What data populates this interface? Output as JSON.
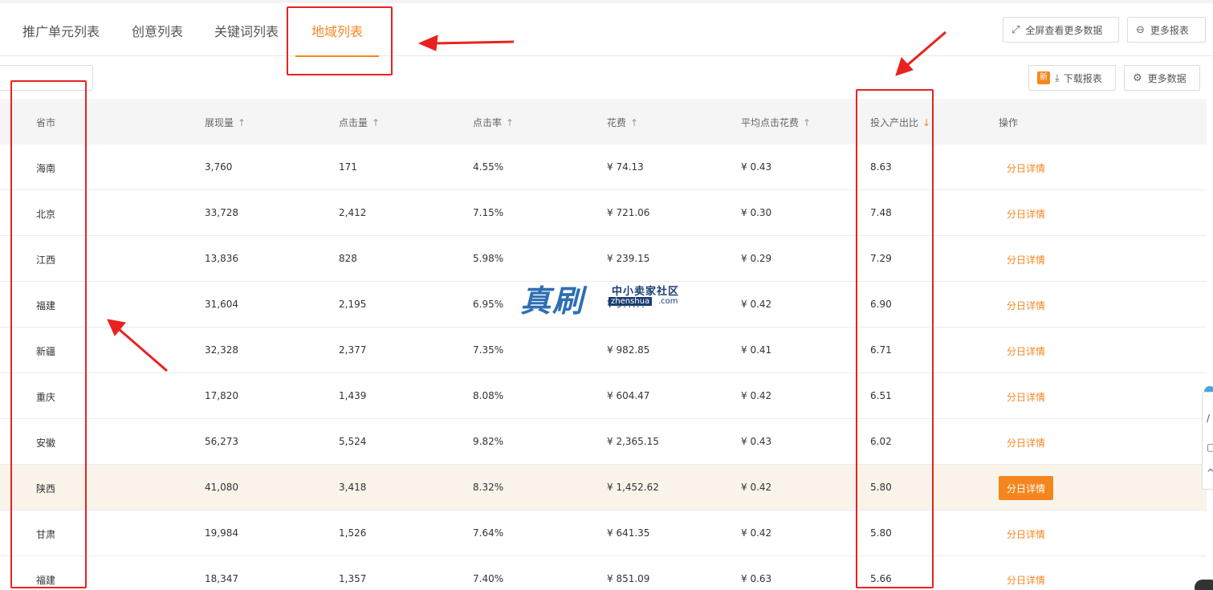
{
  "tabs": [
    {
      "label": "推广单元列表"
    },
    {
      "label": "创意列表"
    },
    {
      "label": "关键词列表"
    },
    {
      "label": "地域列表"
    }
  ],
  "toolbar": {
    "fullscreen_label": "全屏查看更多数据",
    "more_reports_label": "更多报表",
    "new_badge": "新",
    "download_label": "下载报表",
    "more_data_label": "更多数据"
  },
  "table": {
    "headers": [
      "省市",
      "展现量",
      "点击量",
      "点击率",
      "花费",
      "平均点击花费",
      "投入产出比",
      "操作"
    ],
    "action_label": "分日详情",
    "rows": [
      [
        "海南",
        "3,760",
        "171",
        "4.55%",
        "¥ 74.13",
        "¥ 0.43",
        "8.63"
      ],
      [
        "北京",
        "33,728",
        "2,412",
        "7.15%",
        "¥ 721.06",
        "¥ 0.30",
        "7.48"
      ],
      [
        "江西",
        "13,836",
        "828",
        "5.98%",
        "¥ 239.15",
        "¥ 0.29",
        "7.29"
      ],
      [
        "福建",
        "31,604",
        "2,195",
        "6.95%",
        "¥ 9??.??",
        "¥ 0.42",
        "6.90"
      ],
      [
        "新疆",
        "32,328",
        "2,377",
        "7.35%",
        "¥ 982.85",
        "¥ 0.41",
        "6.71"
      ],
      [
        "重庆",
        "17,820",
        "1,439",
        "8.08%",
        "¥ 604.47",
        "¥ 0.42",
        "6.51"
      ],
      [
        "安徽",
        "56,273",
        "5,524",
        "9.82%",
        "¥ 2,365.15",
        "¥ 0.43",
        "6.02"
      ],
      [
        "陕西",
        "41,080",
        "3,418",
        "8.32%",
        "¥ 1,452.62",
        "¥ 0.42",
        "5.80"
      ],
      [
        "甘肃",
        "19,984",
        "1,526",
        "7.64%",
        "¥ 641.35",
        "¥ 0.42",
        "5.80"
      ],
      [
        "福建",
        "18,347",
        "1,357",
        "7.40%",
        "¥ 851.09",
        "¥ 0.63",
        "5.66"
      ]
    ]
  },
  "watermark": {
    "big": "真刷",
    "small": "中小卖家社区",
    "url": "zhenshua",
    "com": ".com"
  },
  "colors": {
    "accent": "#f5861f",
    "annotation_red": "#e8231f",
    "highlight_row": "#f9f3ea"
  }
}
